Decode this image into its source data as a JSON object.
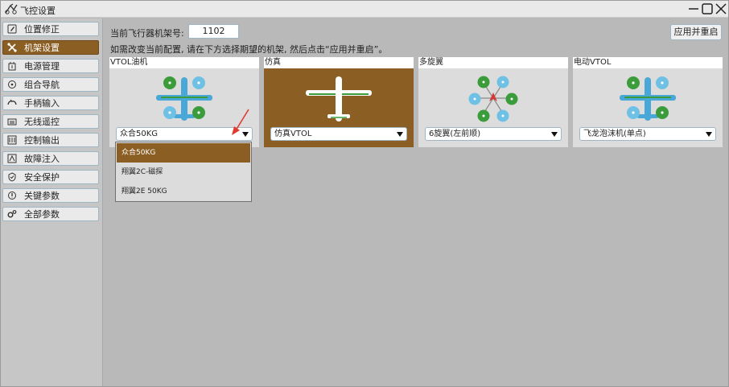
{
  "window": {
    "title": "飞控设置"
  },
  "sidebar": {
    "items": [
      {
        "label": "位置修正",
        "icon": "edit-icon",
        "active": false
      },
      {
        "label": "机架设置",
        "icon": "frame-icon",
        "active": true
      },
      {
        "label": "电源管理",
        "icon": "power-icon",
        "active": false
      },
      {
        "label": "组合导航",
        "icon": "navigation-icon",
        "active": false
      },
      {
        "label": "手柄输入",
        "icon": "gamepad-icon",
        "active": false
      },
      {
        "label": "无线遥控",
        "icon": "remote-icon",
        "active": false
      },
      {
        "label": "控制输出",
        "icon": "output-icon",
        "active": false
      },
      {
        "label": "故障注入",
        "icon": "fault-icon",
        "active": false
      },
      {
        "label": "安全保护",
        "icon": "shield-icon",
        "active": false
      },
      {
        "label": "关键参数",
        "icon": "info-icon",
        "active": false
      },
      {
        "label": "全部参数",
        "icon": "gears-icon",
        "active": false
      }
    ]
  },
  "main": {
    "frame_label": "当前飞行器机架号:",
    "frame_number": "1102",
    "hint": "如需改变当前配置, 请在下方选择期望的机架, 然后点击“应用并重启”。",
    "apply_label": "应用并重启",
    "cards": [
      {
        "title": "VTOL油机",
        "selected": "众合50KG",
        "image": "vtol-quadplane-icon"
      },
      {
        "title": "仿真",
        "selected": "仿真VTOL",
        "image": "airplane-icon"
      },
      {
        "title": "多旋翼",
        "selected": "6旋翼(左前顺)",
        "image": "hexacopter-icon"
      },
      {
        "title": "电动VTOL",
        "selected": "飞龙泡沫机(单点)",
        "image": "vtol-quadplane-icon"
      }
    ],
    "dropdown": {
      "options": [
        "众合50KG",
        "翔翼2C-磁探",
        "翔翼2E 50KG"
      ],
      "selected_index": 0
    }
  },
  "colors": {
    "accent": "#8b5e23",
    "rotor_green": "#3a9c3a",
    "rotor_blue": "#6ec1e4",
    "plane_blue": "#4aa8d8"
  }
}
